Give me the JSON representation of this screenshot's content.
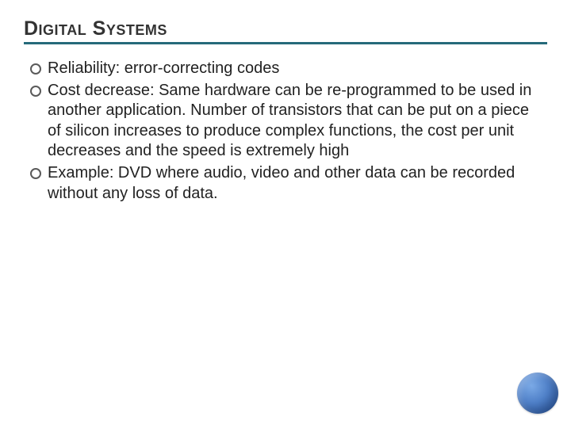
{
  "slide": {
    "title": "Digital Systems",
    "bullets": [
      "Reliability: error-correcting codes",
      "Cost decrease: Same hardware can be re-programmed to be used in another application. Number of transistors that can be put on a piece of silicon increases to produce complex functions, the cost per unit decreases and the speed is extremely high",
      "Example: DVD where audio, video and other data can be recorded without any loss of data."
    ]
  }
}
